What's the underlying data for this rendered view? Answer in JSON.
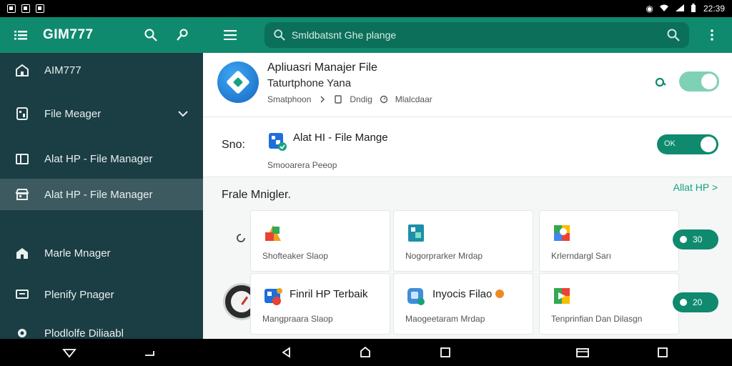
{
  "status_bar": {
    "time": "22:39"
  },
  "sidebar": {
    "title": "GIM777",
    "items": [
      {
        "label": "AIM777",
        "icon": "home-icon"
      },
      {
        "label": "File Meager",
        "icon": "file-icon",
        "expandable": true
      },
      {
        "label": "Alat HP - File Manager",
        "icon": "folder-icon"
      },
      {
        "label": "Alat HP - File Manager",
        "icon": "store-icon",
        "active": true
      },
      {
        "label": "Marle Mnager",
        "icon": "home-icon"
      },
      {
        "label": "Plenify Pnager",
        "icon": "screen-icon"
      },
      {
        "label": "Plodlolfe Diliaabl",
        "icon": "gear-icon"
      }
    ]
  },
  "topbar": {
    "search_placeholder": "Smldbatsnt Ghe plange"
  },
  "app_card": {
    "title_line1": "Apliuasri Manajer File",
    "title_line2": "Taturtphone Yana",
    "meta": [
      "Smatphoon",
      "Dndig",
      "Mlalcdaar"
    ],
    "toggle_on": true
  },
  "sno_card": {
    "label": "Sno:",
    "title": "Alat HI - File Mange",
    "subtitle": "Smooarera Peeop",
    "toggle_text": "OK"
  },
  "section": {
    "title": "Frale Mnigler.",
    "link": "Allat HP >"
  },
  "grid": [
    {
      "title": "",
      "subtitle": "Shofteaker Slaop"
    },
    {
      "title": "",
      "subtitle": "Nogorprarker Mrdap"
    },
    {
      "title": "",
      "subtitle": "Krlerndargl Sarı",
      "pill": "30"
    },
    {
      "title": "Finril HP Terbaik",
      "subtitle": "Mangpraara Slaop"
    },
    {
      "title": "Inyocis Filao",
      "subtitle": "Maogeetaram Mrdap"
    },
    {
      "title": "",
      "subtitle": "Tenprinfian Dan Dilasgn",
      "pill": "20"
    }
  ],
  "colors": {
    "brand": "#0f8a6e",
    "sidebar_bg": "#1b3d44",
    "sidebar_active": "#3d5a60",
    "toggle_light": "#7fd1b5"
  }
}
